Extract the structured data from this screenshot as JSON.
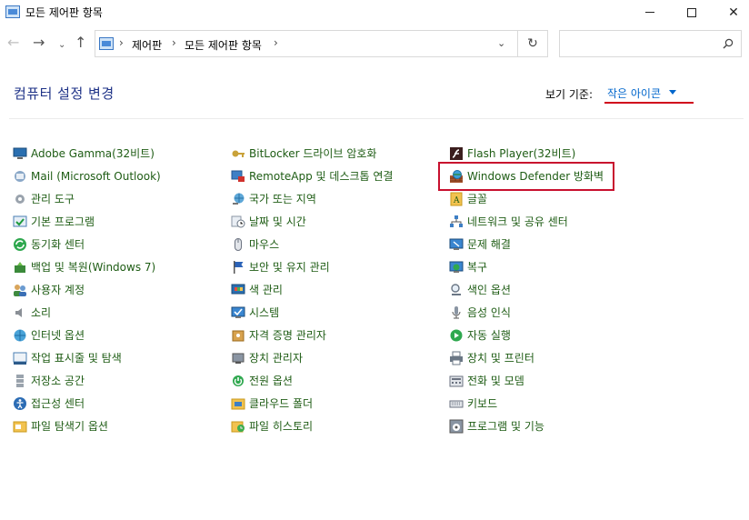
{
  "window": {
    "title": "모든 제어판 항목",
    "min_glyph": "",
    "max_glyph": "",
    "close_glyph": "✕"
  },
  "address": {
    "crumbs": [
      "제어판",
      "모든 제어판 항목"
    ],
    "sep": "›",
    "dropdown_glyph": "⌄",
    "refresh_glyph": "↻"
  },
  "nav": {
    "back": "←",
    "forward": "→",
    "recent": "⌄",
    "up": "↑"
  },
  "header": {
    "title": "컴퓨터 설정 변경",
    "view_by_label": "보기 기준:",
    "view_by_value": "작은 아이콘"
  },
  "colors": {
    "link": "#1e5c14",
    "title": "#1e3287",
    "highlight": "#c8102e",
    "accent": "#0066cc"
  },
  "items": {
    "col1": [
      {
        "label": "Adobe Gamma(32비트)",
        "icon": "monitor-icon"
      },
      {
        "label": "Mail (Microsoft Outlook)",
        "icon": "mail-icon"
      },
      {
        "label": "관리 도구",
        "icon": "admin-tools-icon"
      },
      {
        "label": "기본 프로그램",
        "icon": "default-programs-icon"
      },
      {
        "label": "동기화 센터",
        "icon": "sync-icon"
      },
      {
        "label": "백업 및 복원(Windows 7)",
        "icon": "backup-icon"
      },
      {
        "label": "사용자 계정",
        "icon": "users-icon"
      },
      {
        "label": "소리",
        "icon": "speaker-icon"
      },
      {
        "label": "인터넷 옵션",
        "icon": "internet-icon"
      },
      {
        "label": "작업 표시줄 및 탐색",
        "icon": "taskbar-icon"
      },
      {
        "label": "저장소 공간",
        "icon": "storage-icon"
      },
      {
        "label": "접근성 센터",
        "icon": "accessibility-icon"
      },
      {
        "label": "파일 탐색기 옵션",
        "icon": "folder-options-icon"
      }
    ],
    "col2": [
      {
        "label": "BitLocker 드라이브 암호화",
        "icon": "bitlocker-key-icon"
      },
      {
        "label": "RemoteApp 및 데스크톱 연결",
        "icon": "remoteapp-icon"
      },
      {
        "label": "국가 또는 지역",
        "icon": "globe-icon"
      },
      {
        "label": "날짜 및 시간",
        "icon": "clock-icon"
      },
      {
        "label": "마우스",
        "icon": "mouse-icon"
      },
      {
        "label": "보안 및 유지 관리",
        "icon": "flag-icon"
      },
      {
        "label": "색 관리",
        "icon": "color-icon"
      },
      {
        "label": "시스템",
        "icon": "system-icon"
      },
      {
        "label": "자격 증명 관리자",
        "icon": "credential-icon"
      },
      {
        "label": "장치 관리자",
        "icon": "device-manager-icon"
      },
      {
        "label": "전원 옵션",
        "icon": "power-icon"
      },
      {
        "label": "클라우드 폴더",
        "icon": "cloud-folder-icon"
      },
      {
        "label": "파일 히스토리",
        "icon": "file-history-icon"
      }
    ],
    "col3": [
      {
        "label": "Flash Player(32비트)",
        "icon": "flash-icon"
      },
      {
        "label": "Windows Defender 방화벽",
        "icon": "firewall-icon"
      },
      {
        "label": "글꼴",
        "icon": "font-icon"
      },
      {
        "label": "네트워크 및 공유 센터",
        "icon": "network-icon"
      },
      {
        "label": "문제 해결",
        "icon": "troubleshoot-icon"
      },
      {
        "label": "복구",
        "icon": "recovery-icon"
      },
      {
        "label": "색인 옵션",
        "icon": "index-icon"
      },
      {
        "label": "음성 인식",
        "icon": "microphone-icon"
      },
      {
        "label": "자동 실행",
        "icon": "autoplay-icon"
      },
      {
        "label": "장치 및 프린터",
        "icon": "printer-icon"
      },
      {
        "label": "전화 및 모뎀",
        "icon": "phone-icon"
      },
      {
        "label": "키보드",
        "icon": "keyboard-icon"
      },
      {
        "label": "프로그램 및 기능",
        "icon": "programs-icon"
      }
    ]
  }
}
